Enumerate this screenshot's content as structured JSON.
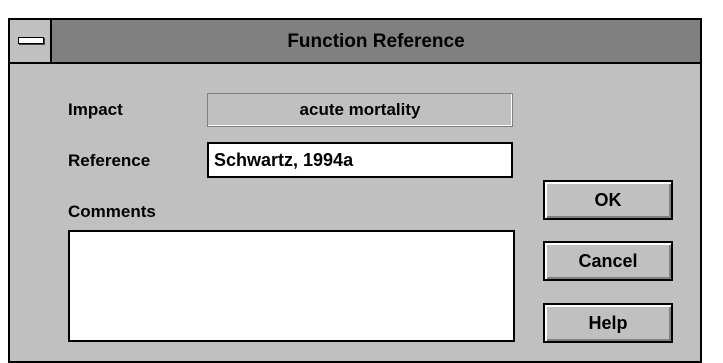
{
  "window": {
    "title": "Function Reference"
  },
  "form": {
    "impact_label": "Impact",
    "impact_value": "acute mortality",
    "reference_label": "Reference",
    "reference_value": "Schwartz, 1994a",
    "comments_label": "Comments",
    "comments_value": ""
  },
  "buttons": {
    "ok": "OK",
    "cancel": "Cancel",
    "help": "Help"
  },
  "colors": {
    "face": "#c0c0c0",
    "titlebar": "#808080",
    "field": "#ffffff"
  }
}
